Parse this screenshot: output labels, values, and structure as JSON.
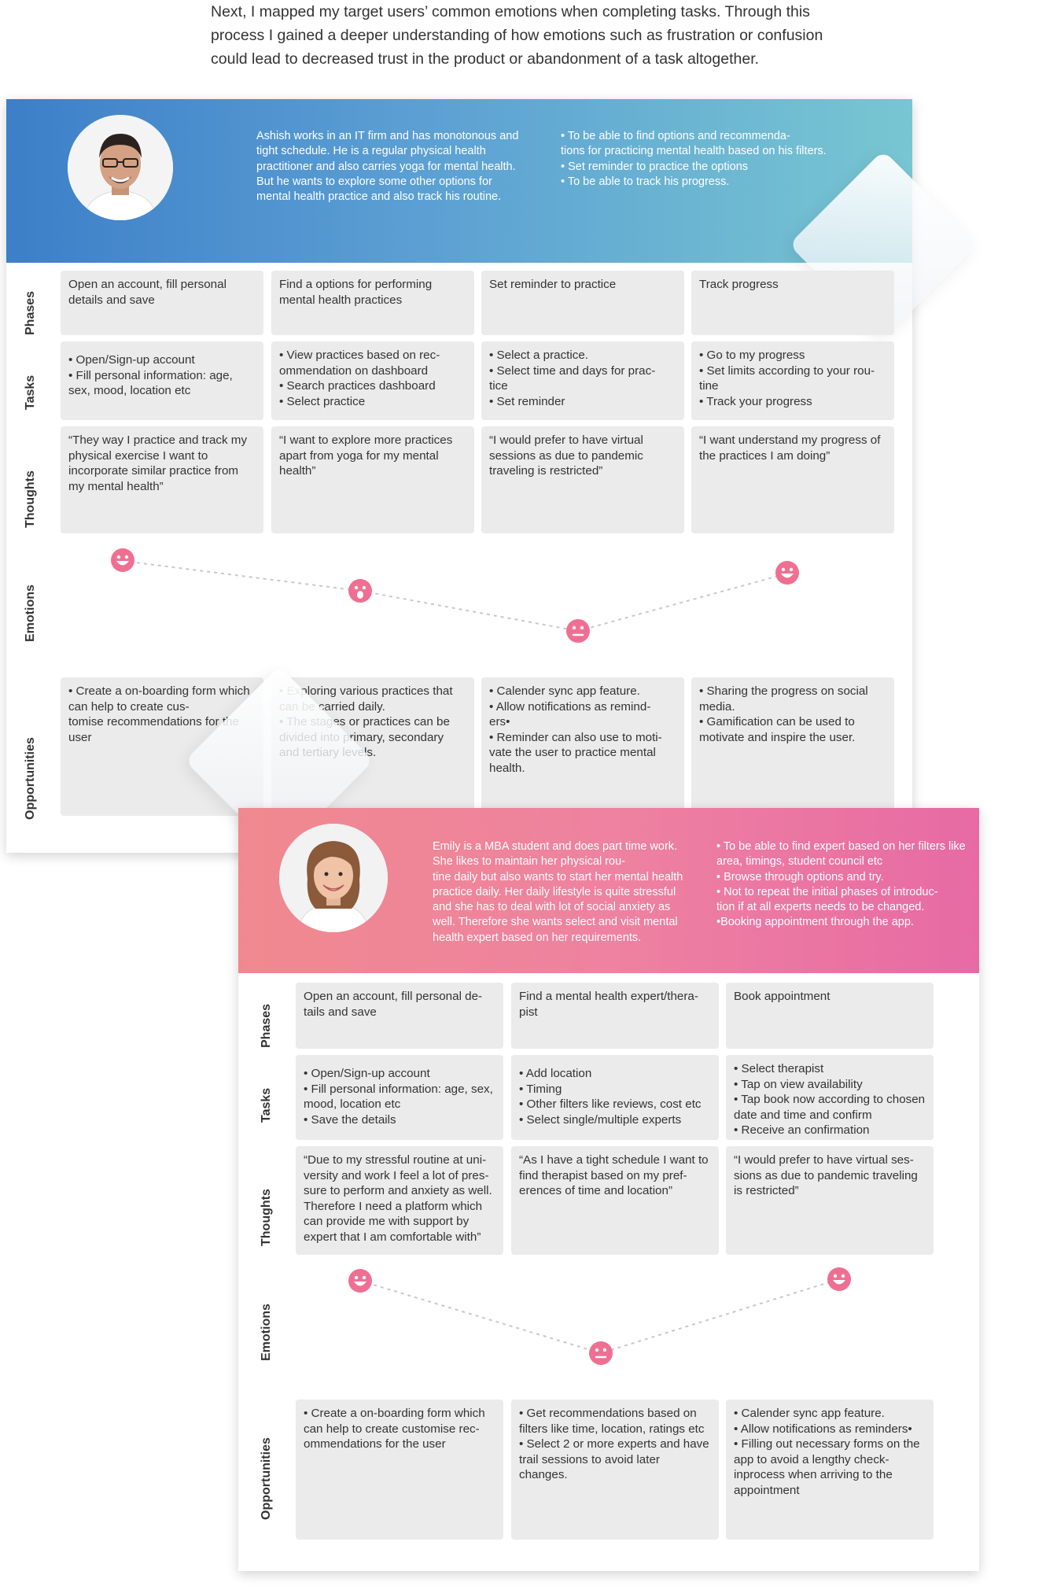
{
  "intro_text": "Next, I mapped my target users’ common emotions when completing tasks. Through this process I gained a deeper understanding of how emotions such as frustration or confusion could lead to decreased trust in the product or abandonment of a task altogether.",
  "row_labels": {
    "phases": "Phases",
    "tasks": "Tasks",
    "thoughts": "Thoughts",
    "emotions": "Emotions",
    "opportunities": "Opportunities"
  },
  "colors": {
    "card1_gradient": [
      "#3d7fc8",
      "#78c6d2"
    ],
    "card2_gradient": [
      "#f0898f",
      "#e76aa4"
    ],
    "cell_bg": "#ebebeb",
    "face_color": "#ef6f92"
  },
  "journey1": {
    "persona": "Ashish works in an IT firm and has monotonous and tight schedule. He is a regular physical health practitioner and also carries yoga for mental health. But he wants to explore some other options for mental health practice and also track his routine.",
    "goals": "• To be able to find options and recommenda-\ntions for practicing mental health based on his filters.\n• Set reminder to practice the options\n• To be able to track his progress.",
    "phases": [
      "Open an account, fill personal details and save",
      "Find a options for performing mental health practices",
      "Set reminder to practice",
      "Track progress"
    ],
    "tasks": [
      "• Open/Sign-up account\n• Fill personal information: age, sex, mood, location etc",
      "• View practices based on rec-\nommendation on dashboard\n• Search practices dashboard\n• Select practice",
      "• Select a practice.\n• Select time and days for prac-\ntice\n• Set reminder",
      "• Go to my progress\n• Set limits according to your rou-\ntine\n• Track your progress"
    ],
    "thoughts": [
      "“They way I practice and track my physical exercise I want to incorporate similar practice from my mental health”",
      "“I want to explore more practices apart from yoga for my mental health”",
      "“I would prefer to have virtual sessions as due to pandemic traveling is restricted”",
      "“I want understand my progress of the practices I am doing”"
    ],
    "emotions": [
      "happy",
      "surprised",
      "neutral",
      "happy"
    ],
    "opportunities": [
      "• Create a on-boarding form which can help to create cus-\ntomise recommendations for the user",
      "• Exploring various practices that can be carried daily.\n• The stages or practices can be divided into primary, secondary and tertiary levels.",
      "• Calender sync app feature.\n• Allow notifications as remind-\ners•\n• Reminder can also use to moti-\nvate the user to practice mental health.",
      "• Sharing the progress on social media.\n• Gamification can be used to motivate and inspire the user."
    ]
  },
  "journey2": {
    "persona": "Emily is a MBA student and does part time work. She likes to maintain her physical rou-\ntine daily but also wants to start her mental health practice daily. Her daily lifestyle is quite stressful and she has to deal with lot of social anxiety as well. Therefore she wants select and visit mental health expert based on her requirements.",
    "goals": "• To be able to find expert based on her filters like area, timings, student council etc\n• Browse through options and try.\n• Not to repeat the initial phases of introduc-\ntion if at all experts needs to be changed.\n•Booking appointment through the app.",
    "phases": [
      "Open an account, fill personal de-\ntails and save",
      "Find a mental health expert/thera-\npist",
      "Book appointment"
    ],
    "tasks": [
      "• Open/Sign-up account\n• Fill personal information: age, sex, mood, location etc\n• Save the details",
      "• Add location\n• Timing\n• Other filters like reviews, cost etc\n• Select single/multiple experts",
      "• Select therapist\n• Tap on view availability\n• Tap book now according to chosen date and time and confirm\n• Receive an confirmation"
    ],
    "thoughts": [
      "“Due to my stressful routine at uni-\nversity and work I feel a lot of pres-\nsure to perform and anxiety as well. Therefore I need a platform which can provide me with support by expert that I am comfortable with”",
      "“As I have a tight schedule I want to find therapist based on my pref-\nerences of time and location”",
      "“I would prefer to have virtual ses-\nsions as due to pandemic  traveling is restricted”"
    ],
    "emotions": [
      "happy",
      "neutral",
      "happy"
    ],
    "opportunities": [
      "• Create a on-boarding form which can help to create customise rec-\nommendations for the user",
      "• Get recommendations based on filters like time, location, ratings etc\n• Select 2 or more experts and have trail sessions to avoid later changes.",
      " • Calender sync app feature.\n • Allow notifications as reminders•\n • Filling out necessary forms on the app to avoid a lengthy check-inprocess when arriving to the appointment"
    ]
  }
}
